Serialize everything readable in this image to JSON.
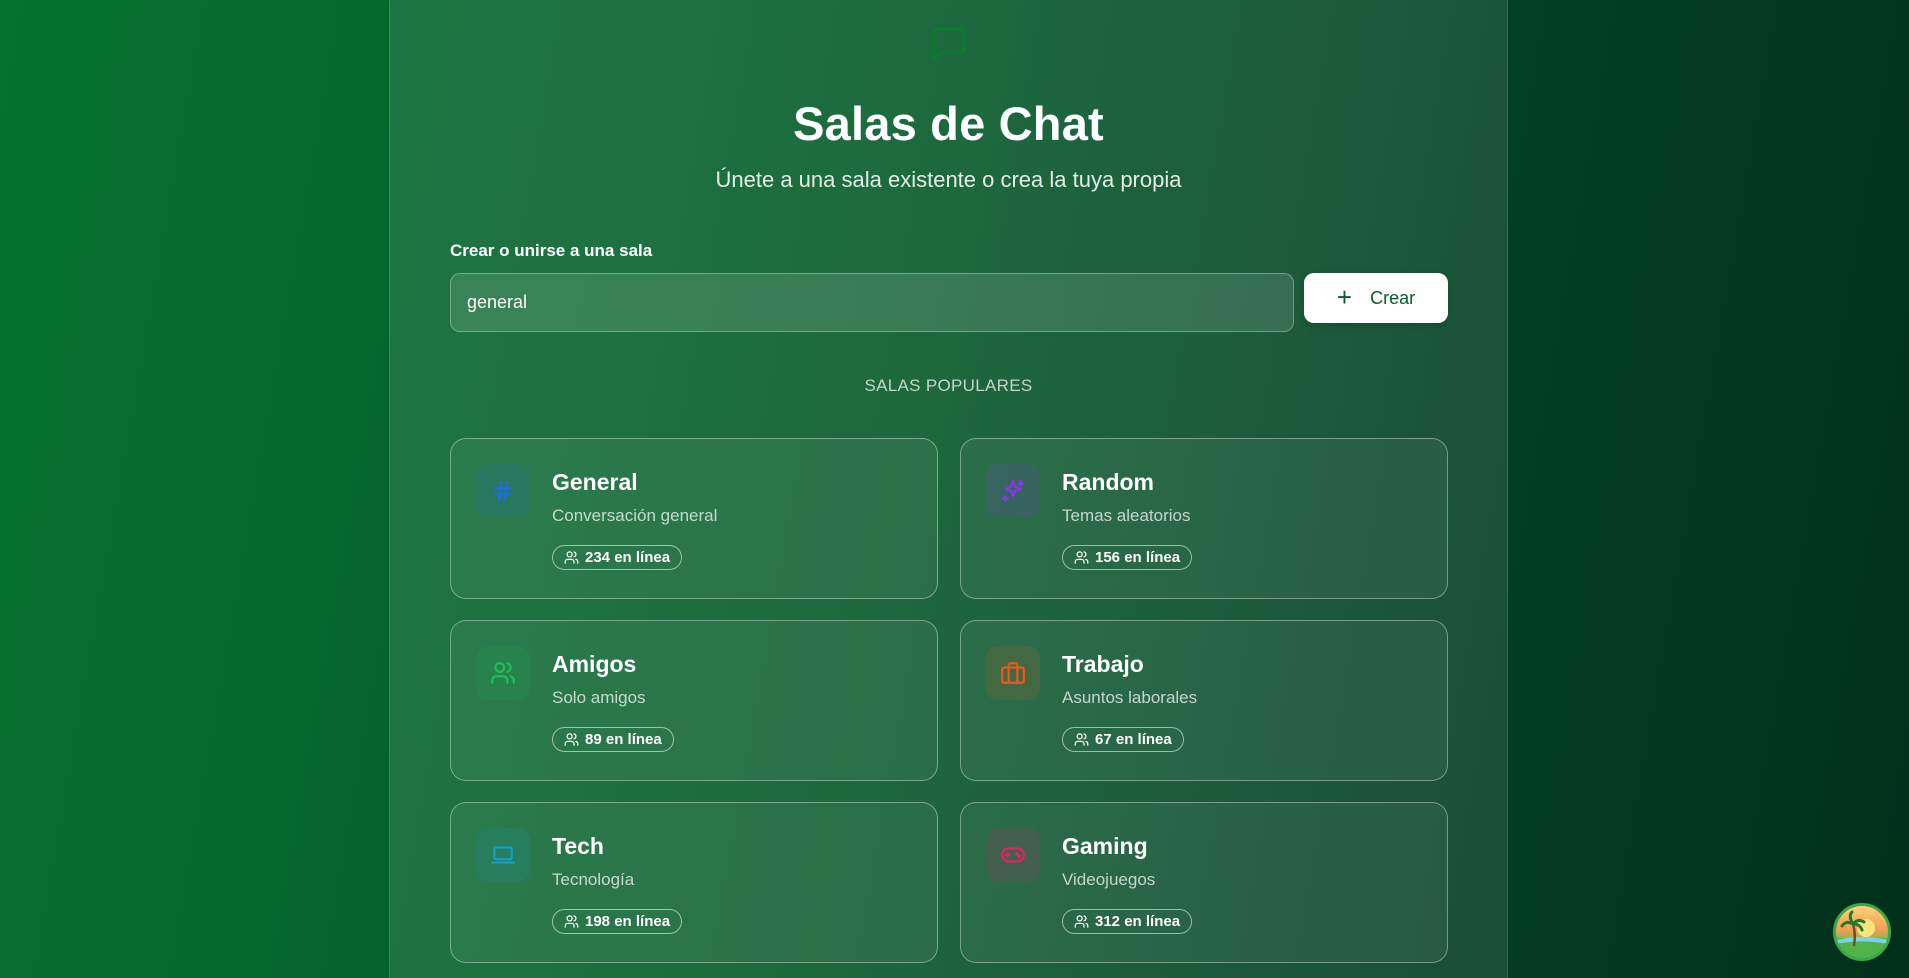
{
  "header": {
    "logo_icon": "message-square-icon",
    "title": "Salas de Chat",
    "subtitle": "Únete a una sala existente o crea la tuya propia"
  },
  "form": {
    "label": "Crear o unirse a una sala",
    "input_value": "general",
    "create_button_icon": "plus-icon",
    "create_button_label": "Crear"
  },
  "popular": {
    "section_title": "SALAS POPULARES",
    "rooms": [
      {
        "name": "General",
        "description": "Conversación general",
        "online": "234 en línea",
        "icon": "hash-icon",
        "color": "#1d6fe0"
      },
      {
        "name": "Random",
        "description": "Temas aleatorios",
        "online": "156 en línea",
        "icon": "sparkles-icon",
        "color": "#8b35f0"
      },
      {
        "name": "Amigos",
        "description": "Solo amigos",
        "online": "89 en línea",
        "icon": "users-icon",
        "color": "#1fbf5a"
      },
      {
        "name": "Trabajo",
        "description": "Asuntos laborales",
        "online": "67 en línea",
        "icon": "briefcase-icon",
        "color": "#ea5a1f"
      },
      {
        "name": "Tech",
        "description": "Tecnología",
        "online": "198 en línea",
        "icon": "laptop-icon",
        "color": "#149ec9"
      },
      {
        "name": "Gaming",
        "description": "Videojuegos",
        "online": "312 en línea",
        "icon": "gamepad-icon",
        "color": "#e0246b"
      }
    ]
  },
  "colors": {
    "background_start": "#05722f",
    "background_end": "#01301b",
    "button_text": "#0b5a2c"
  },
  "floating": {
    "avatar_icon": "palm-tree-sunset-icon"
  }
}
